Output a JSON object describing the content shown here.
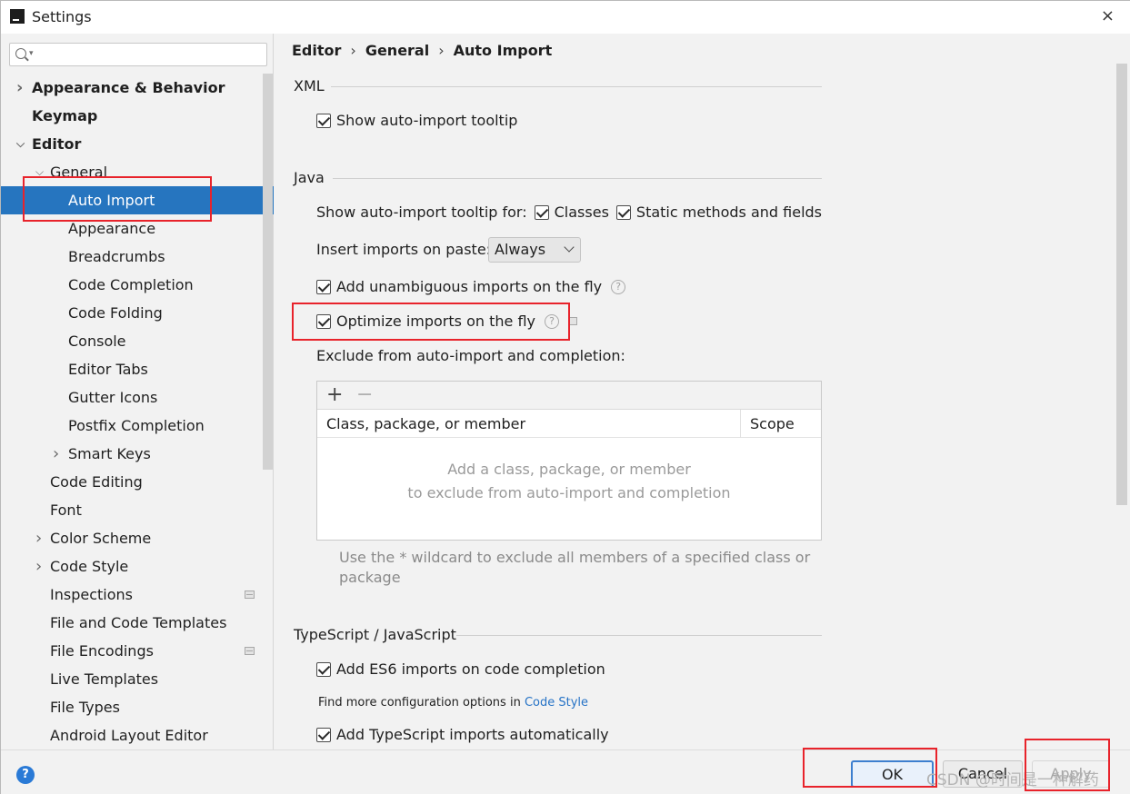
{
  "window": {
    "title": "Settings",
    "close": "×"
  },
  "search": {
    "placeholder": "",
    "value": ""
  },
  "sidebar": {
    "items": [
      {
        "label": "Appearance & Behavior",
        "level": 0,
        "bold": true,
        "arrow": "right"
      },
      {
        "label": "Keymap",
        "level": 0,
        "bold": true,
        "arrow": ""
      },
      {
        "label": "Editor",
        "level": 0,
        "bold": true,
        "arrow": "down"
      },
      {
        "label": "General",
        "level": 1,
        "bold": false,
        "arrow": "down"
      },
      {
        "label": "Auto Import",
        "level": 2,
        "bold": false,
        "arrow": "",
        "selected": true
      },
      {
        "label": "Appearance",
        "level": 2,
        "bold": false,
        "arrow": ""
      },
      {
        "label": "Breadcrumbs",
        "level": 2,
        "bold": false,
        "arrow": ""
      },
      {
        "label": "Code Completion",
        "level": 2,
        "bold": false,
        "arrow": ""
      },
      {
        "label": "Code Folding",
        "level": 2,
        "bold": false,
        "arrow": ""
      },
      {
        "label": "Console",
        "level": 2,
        "bold": false,
        "arrow": ""
      },
      {
        "label": "Editor Tabs",
        "level": 2,
        "bold": false,
        "arrow": ""
      },
      {
        "label": "Gutter Icons",
        "level": 2,
        "bold": false,
        "arrow": ""
      },
      {
        "label": "Postfix Completion",
        "level": 2,
        "bold": false,
        "arrow": ""
      },
      {
        "label": "Smart Keys",
        "level": 2,
        "bold": false,
        "arrow": "right"
      },
      {
        "label": "Code Editing",
        "level": 1,
        "bold": false,
        "arrow": ""
      },
      {
        "label": "Font",
        "level": 1,
        "bold": false,
        "arrow": ""
      },
      {
        "label": "Color Scheme",
        "level": 1,
        "bold": false,
        "arrow": "right"
      },
      {
        "label": "Code Style",
        "level": 1,
        "bold": false,
        "arrow": "right"
      },
      {
        "label": "Inspections",
        "level": 1,
        "bold": false,
        "arrow": "",
        "badge": true
      },
      {
        "label": "File and Code Templates",
        "level": 1,
        "bold": false,
        "arrow": ""
      },
      {
        "label": "File Encodings",
        "level": 1,
        "bold": false,
        "arrow": "",
        "badge": true
      },
      {
        "label": "Live Templates",
        "level": 1,
        "bold": false,
        "arrow": ""
      },
      {
        "label": "File Types",
        "level": 1,
        "bold": false,
        "arrow": ""
      },
      {
        "label": "Android Layout Editor",
        "level": 1,
        "bold": false,
        "arrow": ""
      }
    ]
  },
  "breadcrumb": {
    "part1": "Editor",
    "sep": "›",
    "part2": "General",
    "part3": "Auto Import"
  },
  "xml": {
    "title": "XML",
    "show_tooltip": {
      "label": "Show auto-import tooltip",
      "checked": true
    }
  },
  "java": {
    "title": "Java",
    "tooltip_for_label": "Show auto-import tooltip for:",
    "classes": {
      "label": "Classes",
      "checked": true
    },
    "static_methods": {
      "label": "Static methods and fields",
      "checked": true
    },
    "insert_on_paste": {
      "label": "Insert imports on paste:",
      "value": "Always"
    },
    "unambiguous": {
      "label": "Add unambiguous imports on the fly",
      "checked": true
    },
    "optimize": {
      "label": "Optimize imports on the fly",
      "checked": true
    },
    "exclude_label": "Exclude from auto-import and completion:",
    "table": {
      "add": "+",
      "remove": "−",
      "col_member": "Class, package, or member",
      "col_scope": "Scope",
      "empty_line1": "Add a class, package, or member",
      "empty_line2": "to exclude from auto-import and completion"
    },
    "hint": "Use the * wildcard to exclude all members of a specified class or package"
  },
  "ts": {
    "title": "TypeScript / JavaScript",
    "es6": {
      "label": "Add ES6 imports on code completion",
      "checked": true
    },
    "more_prefix": "Find more configuration options in",
    "more_link": "Code Style",
    "ts_auto": {
      "label": "Add TypeScript imports automatically",
      "checked": true
    }
  },
  "buttons": {
    "help": "?",
    "ok": "OK",
    "cancel": "Cancel",
    "apply": "Apply"
  },
  "watermark": "CSDN @时间是一种解药",
  "colors": {
    "selection": "#2675bf",
    "annotation": "#e8232b",
    "link": "#2673c6"
  }
}
